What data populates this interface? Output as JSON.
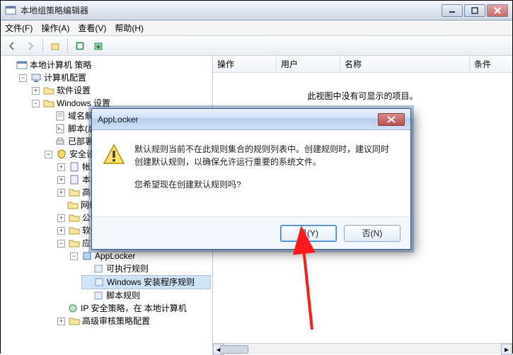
{
  "window": {
    "title": "本地组策略编辑器"
  },
  "menu": {
    "file": "文件(F)",
    "action": "操作(A)",
    "view": "查看(V)",
    "help": "帮助(H)"
  },
  "tree": {
    "root": "本地计算机 策略",
    "computer_config": "计算机配置",
    "software_settings": "软件设置",
    "windows_settings": "Windows 设置",
    "dns_policy": "域名解",
    "scripts": "脚本(启",
    "deployed": "已部署",
    "security_settings": "安全设",
    "account_policies": "帐户",
    "local_policies": "本地",
    "advanced_policies": "高级",
    "network_list": "网络",
    "public_key": "公钥",
    "software_restrict": "软件",
    "app_control": "应用",
    "applocker": "AppLocker",
    "executable_rules": "可执行规则",
    "windows_installer_rules": "Windows 安装程序规则",
    "script_rules": "脚本规则",
    "ip_security": "IP 安全策略，在 本地计算机",
    "advanced_audit": "高级审核策略配置"
  },
  "list": {
    "col_action": "操作",
    "col_user": "用户",
    "col_name": "名称",
    "col_condition": "条件",
    "empty": "此视图中没有可显示的项目。"
  },
  "dialog": {
    "title": "AppLocker",
    "line1": "默认规则当前不在此规则集合的规则列表中。创建规则时，建议同时创建默认规则，以确保允许运行重要的系统文件。",
    "line2": "您希望现在创建默认规则吗?",
    "yes": "是(Y)",
    "no": "否(N)"
  }
}
